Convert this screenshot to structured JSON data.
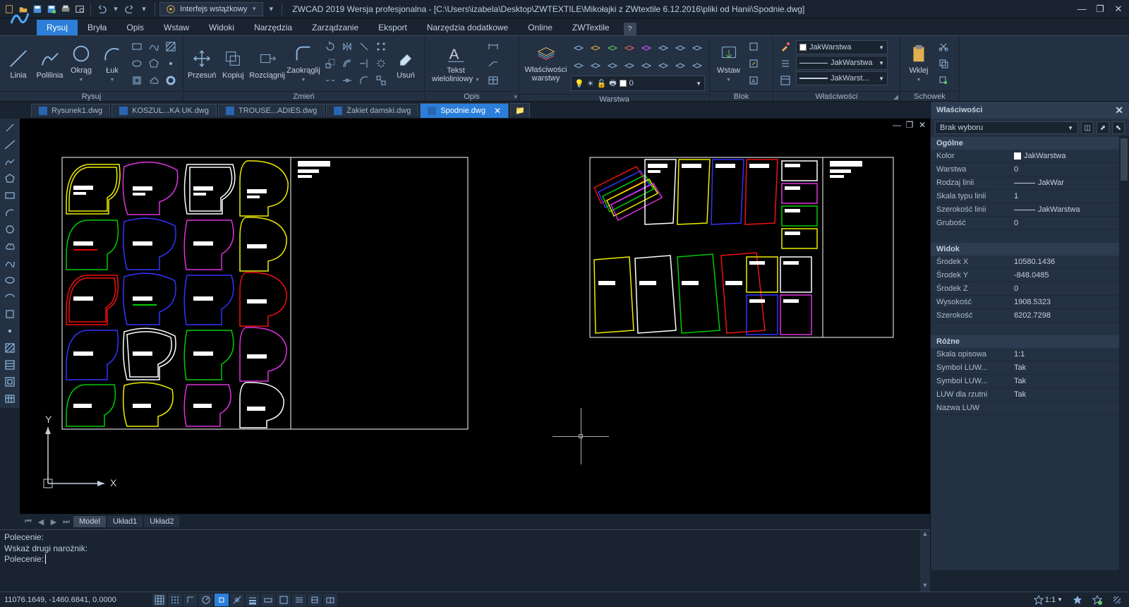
{
  "title": "ZWCAD 2019 Wersja profesjonalna - [C:\\Users\\izabela\\Desktop\\ZWTEXTILE\\Mikołajki z ZWtextile 6.12.2016\\pliki od Hanii\\Spodnie.dwg]",
  "qat_dropdown": "Interfejs wstążkowy",
  "tabs": {
    "active": "Rysuj",
    "items": [
      "Rysuj",
      "Bryła",
      "Opis",
      "Wstaw",
      "Widoki",
      "Narzędzia",
      "Zarządzanie",
      "Eksport",
      "Narzędzia dodatkowe",
      "Online",
      "ZWTextile"
    ]
  },
  "ribbon": {
    "draw": {
      "title": "Rysuj",
      "linia": "Linia",
      "polilinia": "Polilinia",
      "okrag": "Okrąg",
      "luk": "Łuk"
    },
    "edit": {
      "title": "Zmień",
      "przesun": "Przesuń",
      "kopiuj": "Kopiuj",
      "rozciagnij": "Rozciągnij",
      "zaokraglij": "Zaokrąglij",
      "usun": "Usuń"
    },
    "annot": {
      "title": "Opis",
      "tekst": "Tekst\nwieloliniowy"
    },
    "layer": {
      "title": "Warstwa",
      "btn": "Właściwości\nwarstwy",
      "current": "0"
    },
    "block": {
      "title": "Blok",
      "btn": "Wstaw"
    },
    "props": {
      "title": "Właściwości",
      "color": "JakWarstwa",
      "ltype": "JakWarstwa",
      "lweight": "JakWarst..."
    },
    "clip": {
      "title": "Schowek",
      "btn": "Wklej"
    }
  },
  "doc_tabs": [
    {
      "label": "Rysunek1.dwg",
      "active": false
    },
    {
      "label": "KOSZUL...KA UK.dwg",
      "active": false
    },
    {
      "label": "TROUSE...ADIES.dwg",
      "active": false
    },
    {
      "label": "Żakiet damski.dwg",
      "active": false
    },
    {
      "label": "Spodnie.dwg",
      "active": true
    }
  ],
  "layout_tabs": {
    "items": [
      "Model",
      "Układ1",
      "Układ2"
    ],
    "active": "Model"
  },
  "command": {
    "history": [
      "Polecenie:",
      "Wskaż drugi narożnik:"
    ],
    "prompt": "Polecenie: "
  },
  "status": {
    "coords": "11076.1649, -1460.6841, 0.0000",
    "scale": "1:1"
  },
  "properties": {
    "title": "Właściwości",
    "selection": "Brak wyboru",
    "groups": {
      "ogolne": "Ogólne",
      "widok": "Widok",
      "rozne": "Różne"
    },
    "ogolne": {
      "Kolor": "JakWarstwa",
      "Warstwa": "0",
      "Rodzaj linii": "JakWar",
      "Skala typu linii": "1",
      "Szerokość linii": "JakWarstwa",
      "Grubość": "0"
    },
    "widok": {
      "Środek X": "10580.1436",
      "Środek Y": "-848.0485",
      "Środek Z": "0",
      "Wysokość": "1908.5323",
      "Szerokość": "6202.7298"
    },
    "rozne": {
      "Skala opisowa": "1:1",
      "Symbol LUW...": "Tak",
      "Symbol LUW... ": "Tak",
      "LUW dla rzutni": "Tak",
      "Nazwa LUW": ""
    }
  },
  "ucs": {
    "x": "X",
    "y": "Y"
  }
}
